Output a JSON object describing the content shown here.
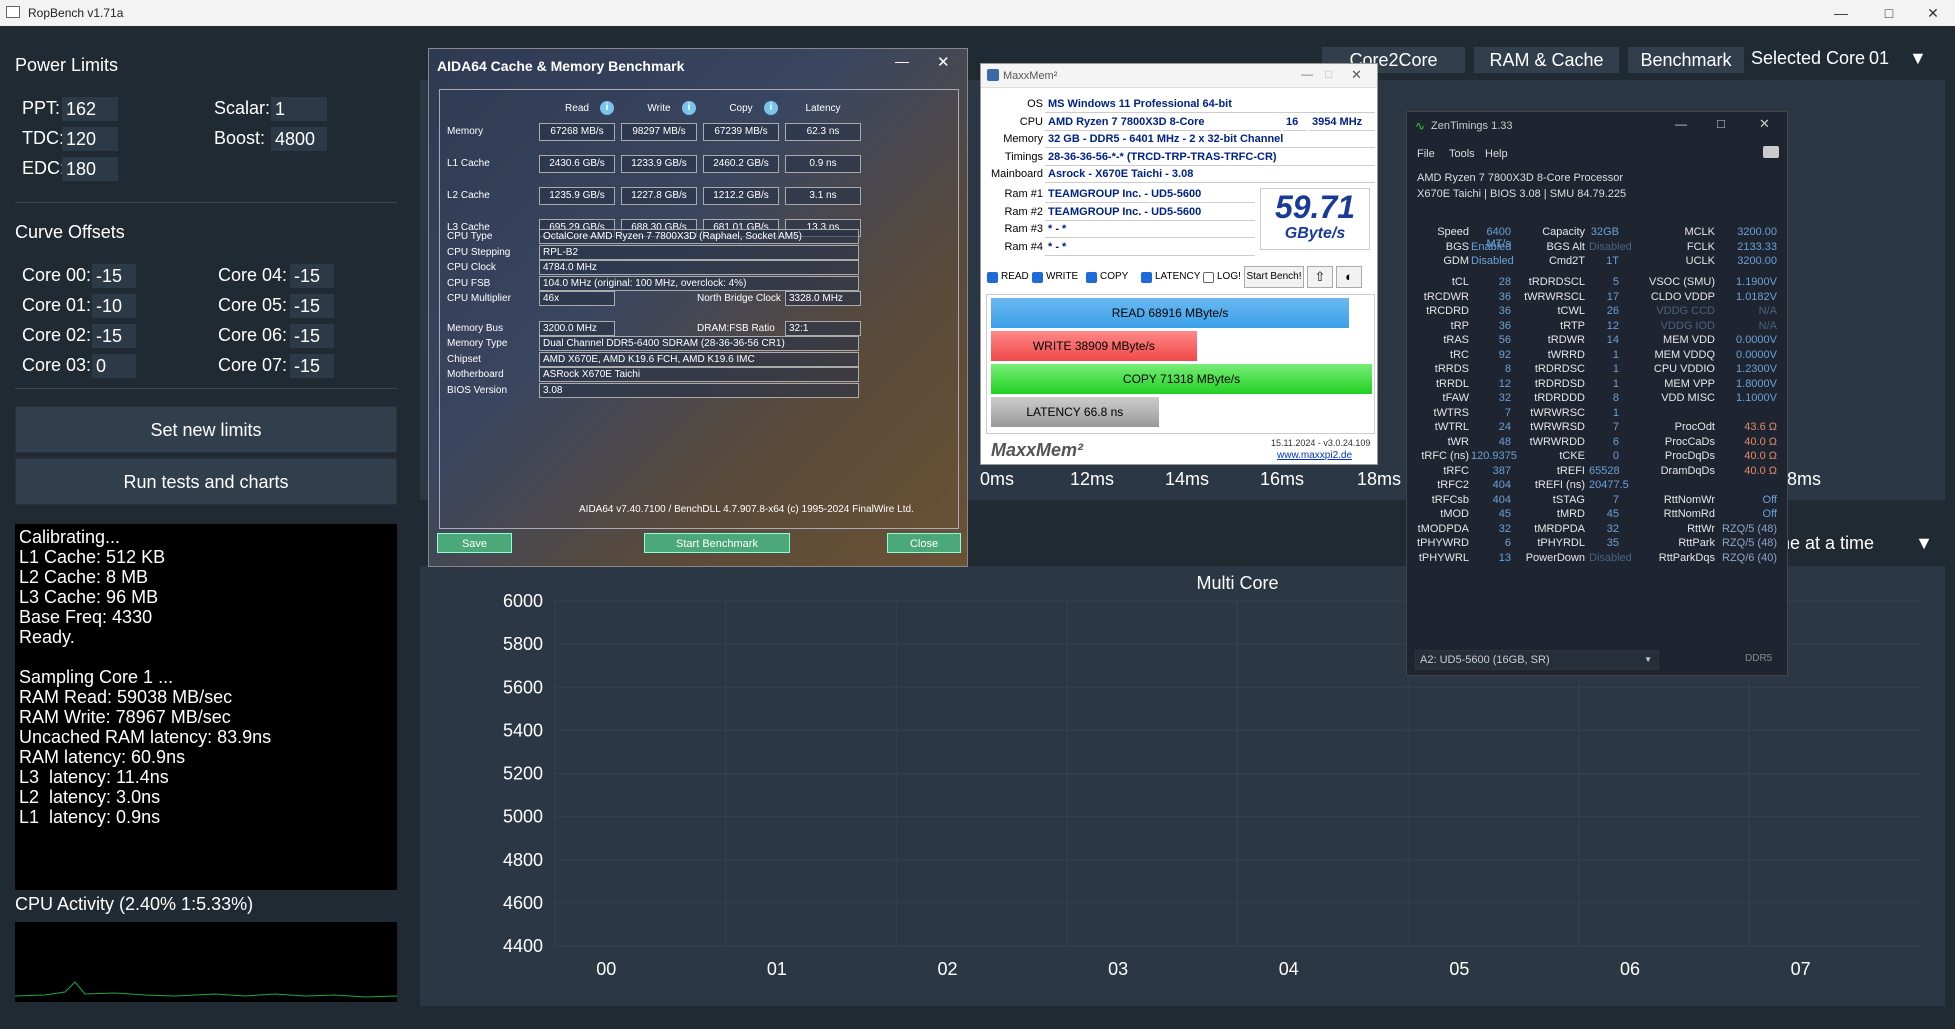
{
  "window": {
    "title": "RopBench v1.71a"
  },
  "power_limits": {
    "heading": "Power Limits",
    "ppt_label": "PPT:",
    "ppt": "162",
    "tdc_label": "TDC:",
    "tdc": "120",
    "edc_label": "EDC:",
    "edc": "180",
    "scalar_label": "Scalar:",
    "scalar": "1",
    "boost_label": "Boost:",
    "boost": "4800"
  },
  "curve_offsets": {
    "heading": "Curve Offsets",
    "cores": [
      {
        "label": "Core 00:",
        "value": "-15"
      },
      {
        "label": "Core 01:",
        "value": "-10"
      },
      {
        "label": "Core 02:",
        "value": "-15"
      },
      {
        "label": "Core 03:",
        "value": "0"
      },
      {
        "label": "Core 04:",
        "value": "-15"
      },
      {
        "label": "Core 05:",
        "value": "-15"
      },
      {
        "label": "Core 06:",
        "value": "-15"
      },
      {
        "label": "Core 07:",
        "value": "-15"
      }
    ]
  },
  "buttons": {
    "set_limits": "Set new limits",
    "run_tests": "Run tests and charts"
  },
  "console_lines": [
    "Calibrating...",
    "L1 Cache: 512 KB",
    "L2 Cache: 8 MB",
    "L3 Cache: 96 MB",
    "Base Freq: 4330",
    "Ready.",
    "",
    "Sampling Core 1 ...",
    "RAM Read: 59038 MB/sec",
    "RAM Write: 78967 MB/sec",
    "Uncached RAM latency: 83.9ns",
    "RAM latency: 60.9ns",
    "L3  latency: 11.4ns",
    "L2  latency: 3.0ns",
    "L1  latency: 0.9ns"
  ],
  "cpu_activity": "CPU Activity (2.40% 1:5.33%)",
  "tabs": {
    "core2core": "Core2Core",
    "ram_cache": "RAM & Cache",
    "benchmark": "Benchmark",
    "selected_core_label": "Selected Core",
    "selected_core": "01"
  },
  "latency_axis": {
    "ticks": [
      "0ms",
      "12ms",
      "14ms",
      "16ms",
      "18ms",
      "28ms"
    ]
  },
  "mode_select": "ne at a time",
  "chart_data": {
    "type": "bar",
    "title": "Multi Core",
    "categories": [
      "00",
      "01",
      "02",
      "03",
      "04",
      "05",
      "06",
      "07"
    ],
    "series": [],
    "ylim": [
      4400,
      6000
    ],
    "yticks": [
      "6000",
      "5800",
      "5600",
      "5400",
      "5200",
      "5000",
      "4800",
      "4600",
      "4400"
    ],
    "grid": true
  },
  "aida": {
    "title": "AIDA64 Cache & Memory Benchmark",
    "cols": [
      "Read",
      "Write",
      "Copy",
      "Latency"
    ],
    "rows": [
      {
        "label": "Memory",
        "vals": [
          "67268 MB/s",
          "98297 MB/s",
          "67239 MB/s",
          "62.3 ns"
        ]
      },
      {
        "label": "L1 Cache",
        "vals": [
          "2430.6 GB/s",
          "1233.9 GB/s",
          "2460.2 GB/s",
          "0.9 ns"
        ]
      },
      {
        "label": "L2 Cache",
        "vals": [
          "1235.9 GB/s",
          "1227.8 GB/s",
          "1212.2 GB/s",
          "3.1 ns"
        ]
      },
      {
        "label": "L3 Cache",
        "vals": [
          "695.29 GB/s",
          "688.30 GB/s",
          "681.01 GB/s",
          "13.3 ns"
        ]
      }
    ],
    "info": [
      {
        "label": "CPU Type",
        "value": "OctalCore AMD Ryzen 7 7800X3D  (Raphael, Socket AM5)"
      },
      {
        "label": "CPU Stepping",
        "value": "RPL-B2"
      },
      {
        "label": "CPU Clock",
        "value": "4784.0 MHz"
      },
      {
        "label": "CPU FSB",
        "value": "104.0 MHz  (original: 100 MHz, overclock: 4%)"
      }
    ],
    "cpu_mult_label": "CPU Multiplier",
    "cpu_mult": "46x",
    "nb_clock_label": "North Bridge Clock",
    "nb_clock": "3328.0 MHz",
    "mem_bus_label": "Memory Bus",
    "mem_bus": "3200.0 MHz",
    "dram_fsb_label": "DRAM:FSB Ratio",
    "dram_fsb": "32:1",
    "info2": [
      {
        "label": "Memory Type",
        "value": "Dual Channel DDR5-6400 SDRAM  (28-36-36-56 CR1)"
      },
      {
        "label": "Chipset",
        "value": "AMD X670E, AMD K19.6 FCH, AMD K19.6 IMC"
      },
      {
        "label": "Motherboard",
        "value": "ASRock X670E Taichi"
      },
      {
        "label": "BIOS Version",
        "value": "3.08"
      }
    ],
    "footer": "AIDA64 v7.40.7100 / BenchDLL 4.7.907.8-x64  (c) 1995-2024 FinalWire Ltd.",
    "save": "Save",
    "start": "Start Benchmark",
    "close": "Close"
  },
  "maxxmem": {
    "title": "MaxxMem²",
    "os_label": "OS",
    "os": "MS Windows 11 Professional 64-bit",
    "cpu_label": "CPU",
    "cpu": "AMD Ryzen 7 7800X3D 8-Core",
    "cpu_threads": "16",
    "cpu_mhz": "3954 MHz",
    "memory_label": "Memory",
    "memory": "32 GB - DDR5 - 6401 MHz - 2 x 32-bit Channel",
    "timings_label": "Timings",
    "timings": "28-36-36-56-*-* (TRCD-TRP-TRAS-TRFC-CR)",
    "mainboard_label": "Mainboard",
    "mainboard": "Asrock - X670E Taichi - 3.08",
    "rams": [
      {
        "label": "Ram #1",
        "value": "TEAMGROUP Inc. - UD5-5600"
      },
      {
        "label": "Ram #2",
        "value": "TEAMGROUP Inc. - UD5-5600"
      },
      {
        "label": "Ram #3",
        "value": "* - *"
      },
      {
        "label": "Ram #4",
        "value": "* - *"
      }
    ],
    "score": "59.71",
    "score_unit": "GByte/s",
    "checks": [
      "READ",
      "WRITE",
      "COPY",
      "LATENCY",
      "LOG!"
    ],
    "start": "Start Bench!",
    "bars": {
      "read": "READ  68916  MByte/s",
      "write": "WRITE  38909  MByte/s",
      "copy": "COPY  71318  MByte/s",
      "latency": "LATENCY  66.8  ns"
    },
    "bar_fill": {
      "read": 0.94,
      "write": 0.54,
      "copy": 1.0,
      "latency": 0.44
    },
    "logo": "MaxxMem²",
    "date": "15.11.2024 - v3.0.24.109",
    "url": "www.maxxpi2.de"
  },
  "zen": {
    "title": "ZenTimings 1.33",
    "menu": [
      "File",
      "Tools",
      "Help"
    ],
    "cpu": "AMD Ryzen 7 7800X3D 8-Core Processor",
    "board": "X670E Taichi | BIOS 3.08 | SMU 84.79.225",
    "top": [
      [
        "Speed",
        "6400 MT/s",
        "Capacity",
        "32GB",
        "MCLK",
        "3200.00"
      ],
      [
        "BGS",
        "Enabled",
        "BGS Alt",
        "Disabled",
        "FCLK",
        "2133.33"
      ],
      [
        "GDM",
        "Disabled",
        "Cmd2T",
        "1T",
        "UCLK",
        "3200.00"
      ]
    ],
    "rows": [
      [
        "tCL",
        "28",
        "tRDRDSCL",
        "5",
        "VSOC (SMU)",
        "1.1900V"
      ],
      [
        "tRCDWR",
        "36",
        "tWRWRSCL",
        "17",
        "CLDO VDDP",
        "1.0182V"
      ],
      [
        "tRCDRD",
        "36",
        "tCWL",
        "26",
        "VDDG CCD",
        "N/A"
      ],
      [
        "tRP",
        "36",
        "tRTP",
        "12",
        "VDDG IOD",
        "N/A"
      ],
      [
        "tRAS",
        "56",
        "tRDWR",
        "14",
        "MEM VDD",
        "0.0000V"
      ],
      [
        "tRC",
        "92",
        "tWRRD",
        "1",
        "MEM VDDQ",
        "0.0000V"
      ],
      [
        "tRRDS",
        "8",
        "tRDRDSC",
        "1",
        "CPU VDDIO",
        "1.2300V"
      ],
      [
        "tRRDL",
        "12",
        "tRDRDSD",
        "1",
        "MEM VPP",
        "1.8000V"
      ],
      [
        "tFAW",
        "32",
        "tRDRDDD",
        "8",
        "VDD MISC",
        "1.1000V"
      ],
      [
        "tWTRS",
        "7",
        "tWRWRSC",
        "1",
        "",
        ""
      ],
      [
        "tWTRL",
        "24",
        "tWRWRSD",
        "7",
        "ProcOdt",
        "43.6 Ω"
      ],
      [
        "tWR",
        "48",
        "tWRWRDD",
        "6",
        "ProcCaDs",
        "40.0 Ω"
      ],
      [
        "tRFC (ns)",
        "120.9375",
        "tCKE",
        "0",
        "ProcDqDs",
        "40.0 Ω"
      ],
      [
        "tRFC",
        "387",
        "tREFI",
        "65528",
        "DramDqDs",
        "40.0 Ω"
      ],
      [
        "tRFC2",
        "404",
        "tREFI (ns)",
        "20477.5",
        "",
        ""
      ],
      [
        "tRFCsb",
        "404",
        "tSTAG",
        "7",
        "RttNomWr",
        "Off"
      ],
      [
        "tMOD",
        "45",
        "tMRD",
        "45",
        "RttNomRd",
        "Off"
      ],
      [
        "tMODPDA",
        "32",
        "tMRDPDA",
        "32",
        "RttWr",
        "RZQ/5 (48)"
      ],
      [
        "tPHYWRD",
        "6",
        "tPHYRDL",
        "35",
        "RttPark",
        "RZQ/5 (48)"
      ],
      [
        "tPHYWRL",
        "13",
        "PowerDown",
        "Disabled",
        "RttParkDqs",
        "RZQ/6 (40)"
      ]
    ],
    "slot": "A2: UD5-5600 (16GB, SR)",
    "ddr": "DDR5"
  },
  "colors": {
    "bg": "#202a33",
    "panel": "#2b3744",
    "button": "#313e4b",
    "read_bar": "#3aa0e8",
    "write_bar": "#f04848",
    "copy_bar": "#22d022",
    "latency_bar": "#9a9a9a"
  }
}
